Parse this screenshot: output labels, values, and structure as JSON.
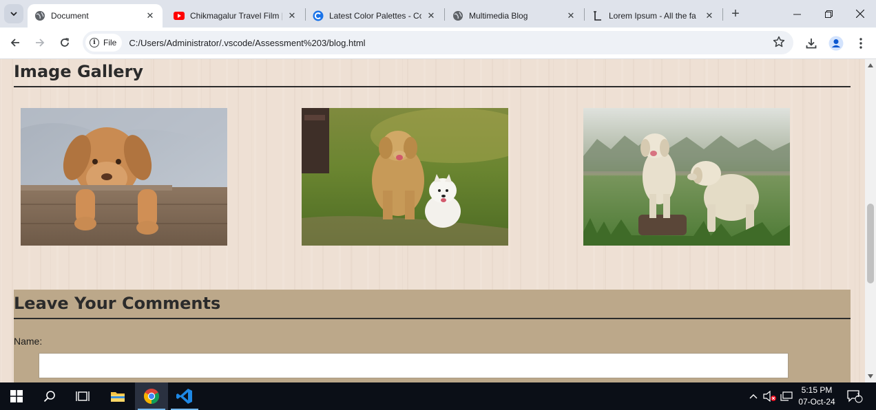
{
  "browser": {
    "tabs": [
      {
        "title": "Document",
        "active": true,
        "favicon": "globe-icon"
      },
      {
        "title": "Chikmagalur Travel Film | ",
        "active": false,
        "favicon": "youtube-icon"
      },
      {
        "title": "Latest Color Palettes - Co",
        "active": false,
        "favicon": "coolors-icon"
      },
      {
        "title": "Multimedia Blog",
        "active": false,
        "favicon": "globe-icon"
      },
      {
        "title": "Lorem Ipsum - All the fa",
        "active": false,
        "favicon": "lorem-icon"
      }
    ],
    "address": {
      "chip_label": "File",
      "url": "C:/Users/Administrator/.vscode/Assessment%203/blog.html"
    }
  },
  "page": {
    "gallery_heading": "Image Gallery",
    "images": [
      {
        "description": "puppy-in-wooden-crate"
      },
      {
        "description": "golden-retriever-and-white-spitz"
      },
      {
        "description": "two-labradors-in-field"
      }
    ],
    "comments_heading": "Leave Your Comments",
    "name_label": "Name:",
    "name_value": ""
  },
  "taskbar": {
    "time": "5:15 PM",
    "date": "07-Oct-24",
    "notification_count": "1"
  },
  "colors": {
    "page_bg": "#eee0d4",
    "comments_bg": "#bca88a",
    "heading_text": "#2b2b2b"
  }
}
